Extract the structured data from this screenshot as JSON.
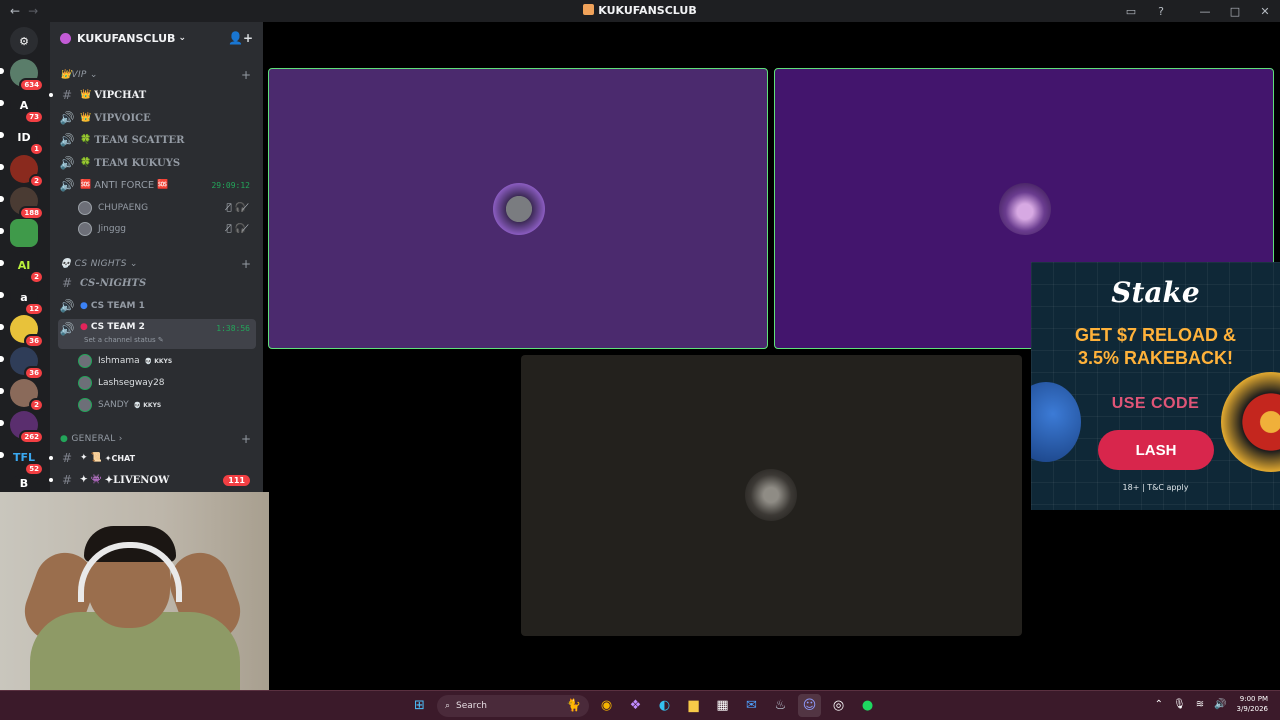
{
  "window": {
    "title": "KUKUFANSCLUB"
  },
  "server": {
    "name": "KUKUFANSCLUB"
  },
  "rail": [
    {
      "label": "",
      "badge": "634"
    },
    {
      "label": "A",
      "badge": "73"
    },
    {
      "label": "ID",
      "badge": "1"
    },
    {
      "label": "",
      "badge": "2"
    },
    {
      "label": "",
      "badge": "188"
    },
    {
      "label": "",
      "badge": ""
    },
    {
      "label": "AI",
      "badge": "2"
    },
    {
      "label": "a",
      "badge": "12"
    },
    {
      "label": "",
      "badge": "36"
    },
    {
      "label": "",
      "badge": "36"
    },
    {
      "label": "",
      "badge": "2"
    },
    {
      "label": "",
      "badge": "262"
    },
    {
      "label": "",
      "badge": "52"
    },
    {
      "label": "B",
      "badge": ""
    }
  ],
  "categories": {
    "vip": "VIP",
    "cs_nights": "CS NIGHTS",
    "general": "GENERAL"
  },
  "channels": {
    "vipchat": "VIPCHAT",
    "vipvoice": "VIPVOICE",
    "team_scatter": "TEAM SCATTER",
    "team_kukuys": "TEAM KUKUYS",
    "anti_force": "ANTI FORCE",
    "anti_force_timer": "29:09:12",
    "cs_nights": "CS-NIGHTS",
    "cs_team1": "CS TEAM 1",
    "cs_team2": "CS TEAM 2",
    "cs_team2_timer": "1:38:56",
    "cs_team2_status": "Set a channel status",
    "chat": "✦CHAT",
    "livenow": "✦LIVENOW",
    "livenow_mentions": "111"
  },
  "members": {
    "chupaeng": "CHUPAENG",
    "jinggg": "Jinggg",
    "ishmama": "Ishmama",
    "lashsegway": "Lashsegway28",
    "sandy": "SANDY",
    "tag": "KKYS"
  },
  "ad": {
    "brand": "Stake",
    "headline_1": "GET $7 RELOAD &",
    "headline_2": "3.5% RAKEBACK!",
    "code_label": "USE CODE",
    "code": "LASH",
    "fine_print": "18+ | T&C apply"
  },
  "taskbar": {
    "search_placeholder": "Search",
    "time": "9:00 PM",
    "date": "3/9/2026"
  },
  "colors": {
    "speaking_border": "#5fe07a",
    "mention_red": "#f23f43",
    "voice_green": "#23a55a"
  }
}
